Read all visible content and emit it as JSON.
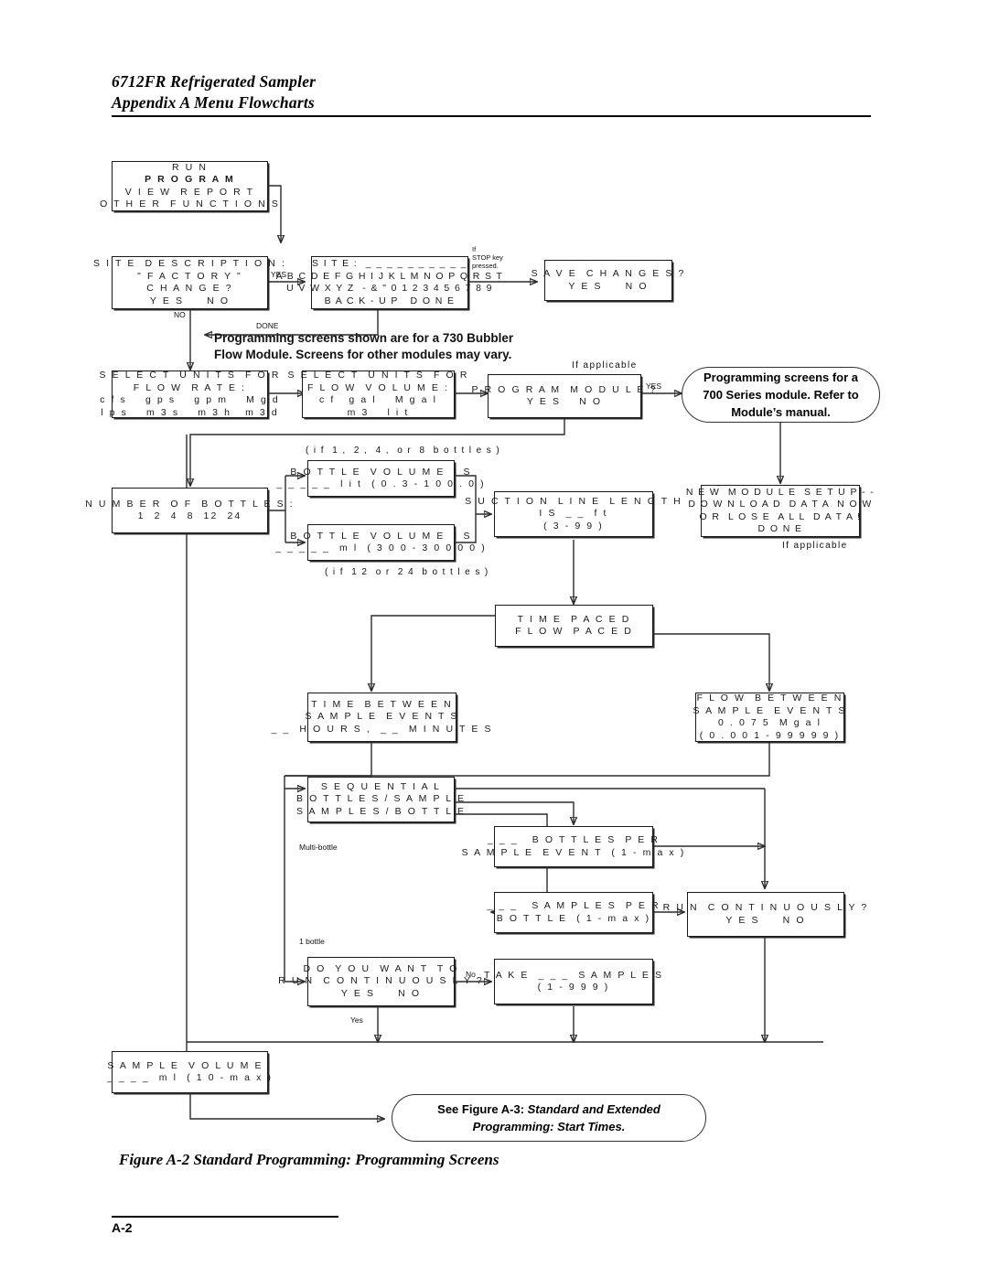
{
  "header": {
    "line1": "6712FR Refrigerated Sampler",
    "line2": "Appendix A  Menu Flowcharts"
  },
  "boxes": {
    "main_menu": {
      "lines": [
        "R U N",
        "P R O G R A M",
        "V I E W  R E P O R T",
        "O T H E R  F U N C T I O N S"
      ]
    },
    "site_description": {
      "lines": [
        "S I T E  D E S C R I P T I O N :",
        "\" F A C T O R Y \"",
        "C H A N G E ?",
        "Y E S     N O"
      ]
    },
    "site_entry": {
      "lines": [
        "S I T E :  _ _ _ _ _ _ _ _ _ _",
        "A B C D E F G H I J K L M N O P Q R S T",
        "U V W X Y Z  - & \" 0 1 2 3 4 5 6 7 8 9",
        "B A C K - U P   D O N E"
      ]
    },
    "save_changes": {
      "lines": [
        "S A V E  C H A N G E S ?",
        "Y E S     N O"
      ]
    },
    "units_flow_rate": {
      "lines": [
        "S E L E C T  U N I T S  F O R",
        "F L O W  R A T E :",
        "c f s    g p s    g p m    M g d",
        "l p s    m 3 s    m 3 h   m 3 d"
      ]
    },
    "units_flow_vol": {
      "lines": [
        "S E L E C T  U N I T S  F O R",
        "F L O W  V O L U M E :",
        "c f   g a l    M g a l",
        "m 3    l i t"
      ]
    },
    "program_module": {
      "lines": [
        "P R O G R A M  M O D U L E ?",
        "Y E S    N O"
      ]
    },
    "new_module_setup": {
      "lines": [
        "N E W  M O D U L E  S E T U P - -",
        "D O W N L O A D  D A T A  N O W",
        "O R  L O S E  A L L  D A T A !",
        "D O N E"
      ]
    },
    "number_of_bottles": {
      "lines": [
        "N U M B E R  O F  B O T T L E S :",
        "1  2  4  8  12  24"
      ]
    },
    "bottle_volume_lit": {
      "lines": [
        "B O T T L E  V O L U M E  I S",
        "_ _ _ _ _  l i t  ( 0 . 3 - 1 0 0 . 0 )"
      ]
    },
    "bottle_volume_ml": {
      "lines": [
        "B O T T L E  V O L U M E  I S",
        "_ _ _ _ _  m l  ( 3 0 0 - 3 0 0 0 0 )"
      ]
    },
    "suction_line": {
      "lines": [
        "S U C T I O N  L I N E  L E N G T H",
        "I S  _ _  f t",
        "( 3 - 9 9 )"
      ]
    },
    "paced": {
      "lines": [
        "T I M E  P A C E D",
        "F L O W  P A C E D"
      ]
    },
    "time_between": {
      "lines": [
        "T I M E  B E T W E E N",
        "S A M P L E  E V E N T S",
        "_ _  H O U R S ,  _ _  M I N U T E S"
      ]
    },
    "flow_between": {
      "lines": [
        "F L O W  B E T W E E N",
        "S A M P L E  E V E N T S",
        "0 . 0 7 5  M g a l",
        "( 0 . 0 0 1 - 9 9 9 9 9 )"
      ]
    },
    "sequential": {
      "lines": [
        "S E Q U E N T I A L",
        "B O T T L E S / S A M P L E",
        "S A M P L E S / B O T T L E"
      ]
    },
    "bottles_per": {
      "lines": [
        "_ _ _   B O T T L E S  P E R",
        "S A M P L E  E V E N T  ( 1 - m a x )"
      ]
    },
    "samples_per": {
      "lines": [
        "_ _ _   S A M P L E S  P E R",
        "B O T T L E  ( 1 - m a x )"
      ]
    },
    "run_continuously": {
      "lines": [
        "R U N  C O N T I N U O U S L Y ?",
        "Y E S     N O"
      ]
    },
    "do_you_want": {
      "lines": [
        "D O  Y O U  W A N T  T O",
        "R U N  C O N T I N U O U S L Y ?",
        "Y E S     N O"
      ]
    },
    "take_samples": {
      "lines": [
        "T A K E  _ _ _  S A M P L E S",
        "( 1 - 9 9 9 )"
      ]
    },
    "sample_volume": {
      "lines": [
        "S A M P L E  V O L U M E :",
        "_ _ _ _  m l  ( 1 0 - m a x )"
      ]
    }
  },
  "callouts": {
    "module_700": {
      "line1": "Programming screens for a",
      "line2": "700 Series module. Refer to",
      "line3": "Module’s manual."
    },
    "see_figure": {
      "pre": "See Figure A-3: ",
      "em1": "Standard and Extended",
      "em2": "Programming: Start Times."
    }
  },
  "annotations": {
    "bubbler_note_l1": "Programming screens shown are for a 730 Bubbler",
    "bubbler_note_l2": "Flow Module. Screens for other modules may vary.",
    "if_stop_key": "If\nSTOP key\npressed.",
    "yes_site": "YES",
    "no_site": "NO",
    "done_site": "DONE",
    "yes_module": "YES",
    "if_applicable_top": "If applicable",
    "if_applicable_bottom": "If applicable",
    "if_1248": "( i f  1 ,  2 ,  4 ,  o r  8  b o t t l e s )",
    "if_1224": "( i f  1 2  o r  2 4  b o t t l e s )",
    "multi_bottle": "Multi-bottle",
    "one_bottle": "1 bottle",
    "no_take": "No",
    "yes_run": "Yes"
  },
  "footer": {
    "figure_caption": "Figure A-2  Standard Programming: Programming Screens",
    "page_number": "A-2"
  },
  "colors": {
    "ink": "#1a1a1a",
    "wire": "#2b2b2b",
    "paper": "#ffffff"
  }
}
